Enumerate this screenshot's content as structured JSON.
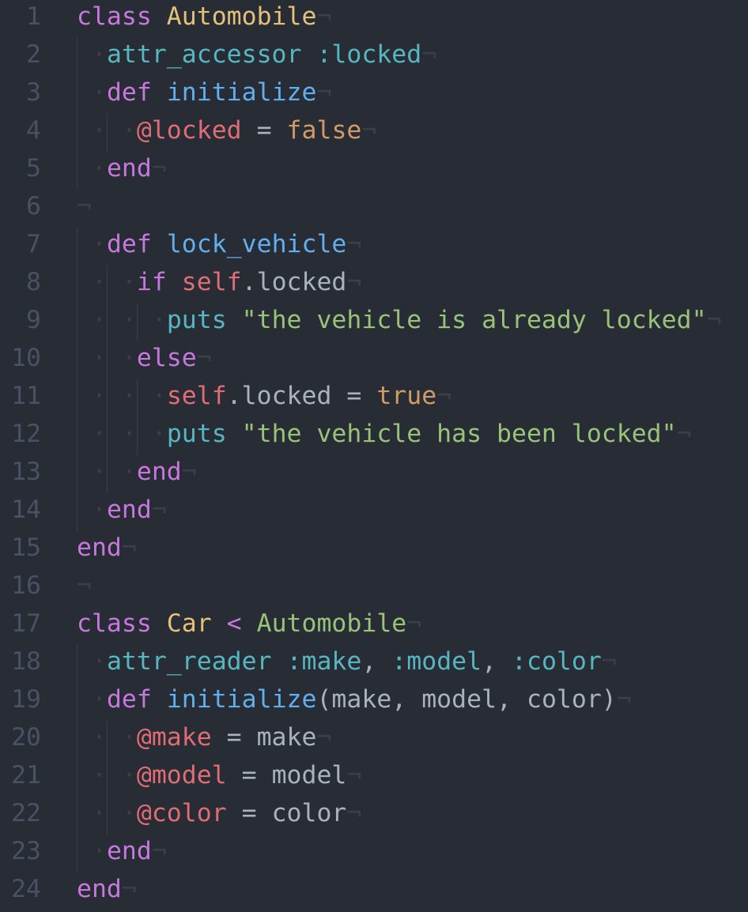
{
  "editor": {
    "language": "ruby",
    "theme": "One Dark",
    "colors": {
      "background": "#282c34",
      "gutter_text": "#495162",
      "invisible": "#3b4048",
      "keyword": "#c678dd",
      "class_name": "#e5c07b",
      "function": "#61afef",
      "symbol": "#56b6c2",
      "instance_variable": "#e06c75",
      "constant": "#d19a66",
      "string": "#98c379",
      "plain": "#abb2bf"
    },
    "eol_marker": "¬",
    "indent_marker": "·",
    "lines": [
      {
        "number": "1",
        "indent": 0,
        "tokens": [
          {
            "t": "class",
            "c": "kw"
          },
          {
            "t": " ",
            "c": "pl"
          },
          {
            "t": "Automobile",
            "c": "cls"
          }
        ]
      },
      {
        "number": "2",
        "indent": 1,
        "tokens": [
          {
            "t": "attr_accessor",
            "c": "sym"
          },
          {
            "t": " ",
            "c": "pl"
          },
          {
            "t": ":locked",
            "c": "sym"
          }
        ]
      },
      {
        "number": "3",
        "indent": 1,
        "tokens": [
          {
            "t": "def",
            "c": "kw"
          },
          {
            "t": " ",
            "c": "pl"
          },
          {
            "t": "initialize",
            "c": "fn"
          }
        ]
      },
      {
        "number": "4",
        "indent": 2,
        "tokens": [
          {
            "t": "@locked",
            "c": "ivar"
          },
          {
            "t": " = ",
            "c": "pl"
          },
          {
            "t": "false",
            "c": "con"
          }
        ]
      },
      {
        "number": "5",
        "indent": 1,
        "tokens": [
          {
            "t": "end",
            "c": "kw"
          }
        ]
      },
      {
        "number": "6",
        "indent": 0,
        "tokens": []
      },
      {
        "number": "7",
        "indent": 1,
        "tokens": [
          {
            "t": "def",
            "c": "kw"
          },
          {
            "t": " ",
            "c": "pl"
          },
          {
            "t": "lock_vehicle",
            "c": "fn"
          }
        ]
      },
      {
        "number": "8",
        "indent": 2,
        "tokens": [
          {
            "t": "if",
            "c": "kw"
          },
          {
            "t": " ",
            "c": "pl"
          },
          {
            "t": "self",
            "c": "ivar"
          },
          {
            "t": ".locked",
            "c": "pl"
          }
        ]
      },
      {
        "number": "9",
        "indent": 3,
        "tokens": [
          {
            "t": "puts",
            "c": "sym"
          },
          {
            "t": " ",
            "c": "pl"
          },
          {
            "t": "\"the vehicle is already locked\"",
            "c": "str"
          }
        ]
      },
      {
        "number": "10",
        "indent": 2,
        "tokens": [
          {
            "t": "else",
            "c": "kw"
          }
        ]
      },
      {
        "number": "11",
        "indent": 3,
        "tokens": [
          {
            "t": "self",
            "c": "ivar"
          },
          {
            "t": ".locked = ",
            "c": "pl"
          },
          {
            "t": "true",
            "c": "con"
          }
        ]
      },
      {
        "number": "12",
        "indent": 3,
        "tokens": [
          {
            "t": "puts",
            "c": "sym"
          },
          {
            "t": " ",
            "c": "pl"
          },
          {
            "t": "\"the vehicle has been locked\"",
            "c": "str"
          }
        ]
      },
      {
        "number": "13",
        "indent": 2,
        "tokens": [
          {
            "t": "end",
            "c": "kw"
          }
        ]
      },
      {
        "number": "14",
        "indent": 1,
        "tokens": [
          {
            "t": "end",
            "c": "kw"
          }
        ]
      },
      {
        "number": "15",
        "indent": 0,
        "tokens": [
          {
            "t": "end",
            "c": "kw"
          }
        ]
      },
      {
        "number": "16",
        "indent": 0,
        "tokens": []
      },
      {
        "number": "17",
        "indent": 0,
        "tokens": [
          {
            "t": "class",
            "c": "kw"
          },
          {
            "t": " ",
            "c": "pl"
          },
          {
            "t": "Car",
            "c": "cls"
          },
          {
            "t": " < ",
            "c": "kw"
          },
          {
            "t": "Automobile",
            "c": "str"
          }
        ]
      },
      {
        "number": "18",
        "indent": 1,
        "tokens": [
          {
            "t": "attr_reader",
            "c": "sym"
          },
          {
            "t": " ",
            "c": "pl"
          },
          {
            "t": ":make",
            "c": "sym"
          },
          {
            "t": ", ",
            "c": "pl"
          },
          {
            "t": ":model",
            "c": "sym"
          },
          {
            "t": ", ",
            "c": "pl"
          },
          {
            "t": ":color",
            "c": "sym"
          }
        ]
      },
      {
        "number": "19",
        "indent": 1,
        "tokens": [
          {
            "t": "def",
            "c": "kw"
          },
          {
            "t": " ",
            "c": "pl"
          },
          {
            "t": "initialize",
            "c": "fn"
          },
          {
            "t": "(make, model, color)",
            "c": "pl"
          }
        ]
      },
      {
        "number": "20",
        "indent": 2,
        "tokens": [
          {
            "t": "@make",
            "c": "ivar"
          },
          {
            "t": " = make",
            "c": "pl"
          }
        ]
      },
      {
        "number": "21",
        "indent": 2,
        "tokens": [
          {
            "t": "@model",
            "c": "ivar"
          },
          {
            "t": " = model",
            "c": "pl"
          }
        ]
      },
      {
        "number": "22",
        "indent": 2,
        "tokens": [
          {
            "t": "@color",
            "c": "ivar"
          },
          {
            "t": " = color",
            "c": "pl"
          }
        ]
      },
      {
        "number": "23",
        "indent": 1,
        "tokens": [
          {
            "t": "end",
            "c": "kw"
          }
        ]
      },
      {
        "number": "24",
        "indent": 0,
        "tokens": [
          {
            "t": "end",
            "c": "kw"
          }
        ]
      }
    ]
  }
}
